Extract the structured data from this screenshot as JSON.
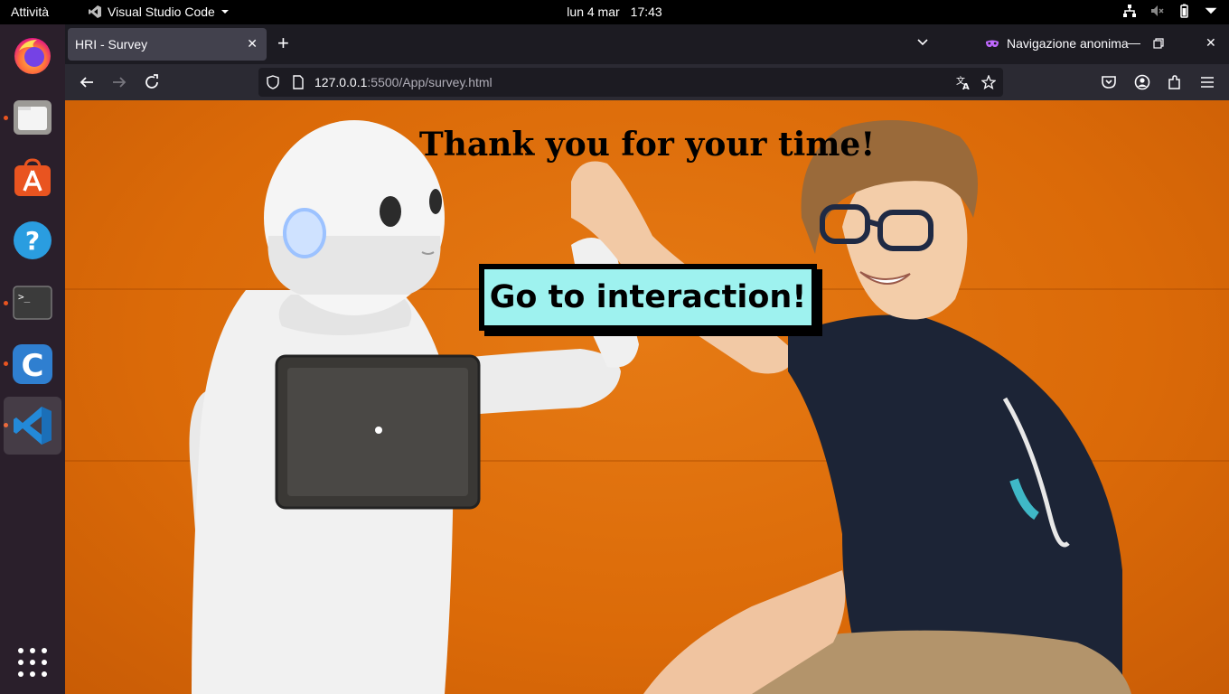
{
  "topbar": {
    "activities": "Attività",
    "app_name": "Visual Studio Code",
    "date": "lun 4 mar",
    "time": "17:43"
  },
  "dock": {
    "items": [
      "firefox-icon",
      "files-icon",
      "app-center-icon",
      "help-icon",
      "terminal-icon",
      "code-c-icon",
      "vscode-icon"
    ],
    "active_item": "vscode-icon"
  },
  "browser": {
    "tab_title": "HRI - Survey",
    "private_label": "Navigazione anonima",
    "url_host": "127.0.0.1",
    "url_rest": ":5500/App/survey.html"
  },
  "page": {
    "title": "Thank you for your time!",
    "button_label": "Go to interaction!",
    "colors": {
      "background": "#dd6c0a",
      "button": "#9ef2ef",
      "text": "#000000"
    }
  }
}
